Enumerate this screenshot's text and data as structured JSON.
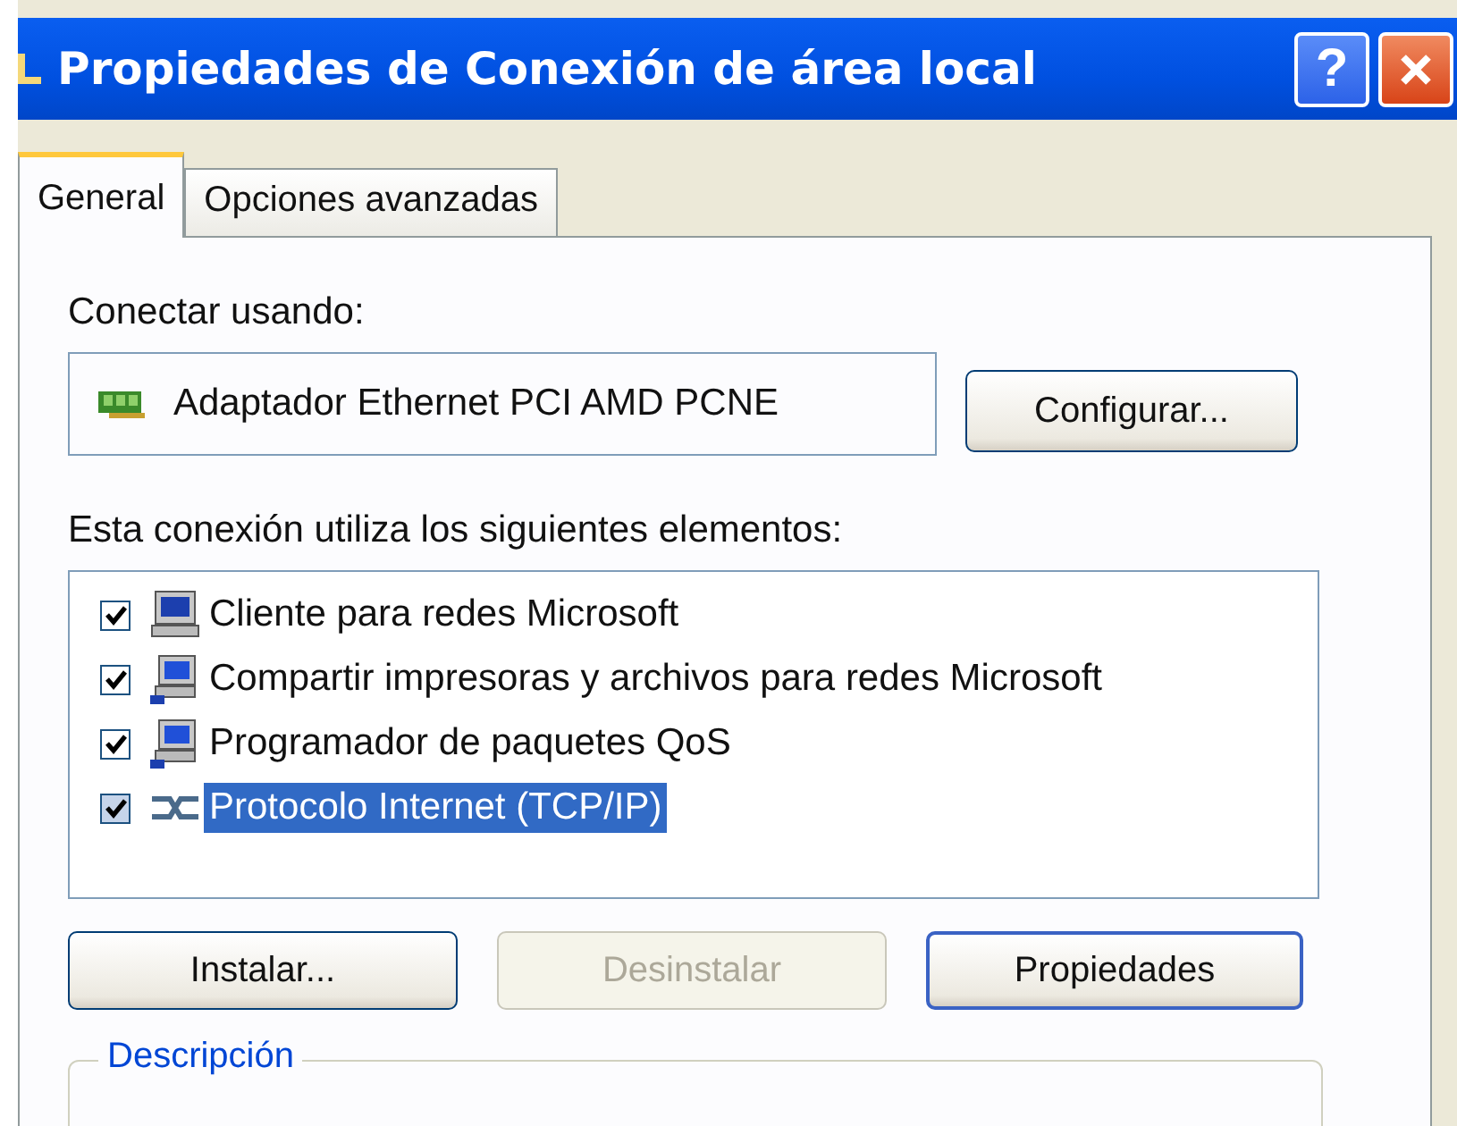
{
  "window": {
    "title": "Propiedades de Conexión de área local",
    "help_button": "?"
  },
  "tabs": [
    {
      "label": "General",
      "selected": true
    },
    {
      "label": "Opciones avanzadas",
      "selected": false
    }
  ],
  "connect_using": {
    "label": "Conectar usando:",
    "adapter": "Adaptador Ethernet PCI AMD PCNE",
    "button": "Configurar..."
  },
  "components": {
    "label": "Esta conexión utiliza los siguientes elementos:",
    "items": [
      {
        "name": "Cliente para redes Microsoft",
        "kind": "client",
        "checked": true,
        "selected": false
      },
      {
        "name": "Compartir impresoras y archivos para redes Microsoft",
        "kind": "service",
        "checked": true,
        "selected": false
      },
      {
        "name": "Programador de paquetes QoS",
        "kind": "service",
        "checked": true,
        "selected": false
      },
      {
        "name": "Protocolo Internet (TCP/IP)",
        "kind": "protocol",
        "checked": true,
        "selected": true
      }
    ]
  },
  "buttons": [
    {
      "label": "Instalar...",
      "disabled": false,
      "default": false
    },
    {
      "label": "Desinstalar",
      "disabled": true,
      "default": false
    },
    {
      "label": "Propiedades",
      "disabled": false,
      "default": true
    }
  ],
  "description": {
    "legend": "Descripción"
  }
}
